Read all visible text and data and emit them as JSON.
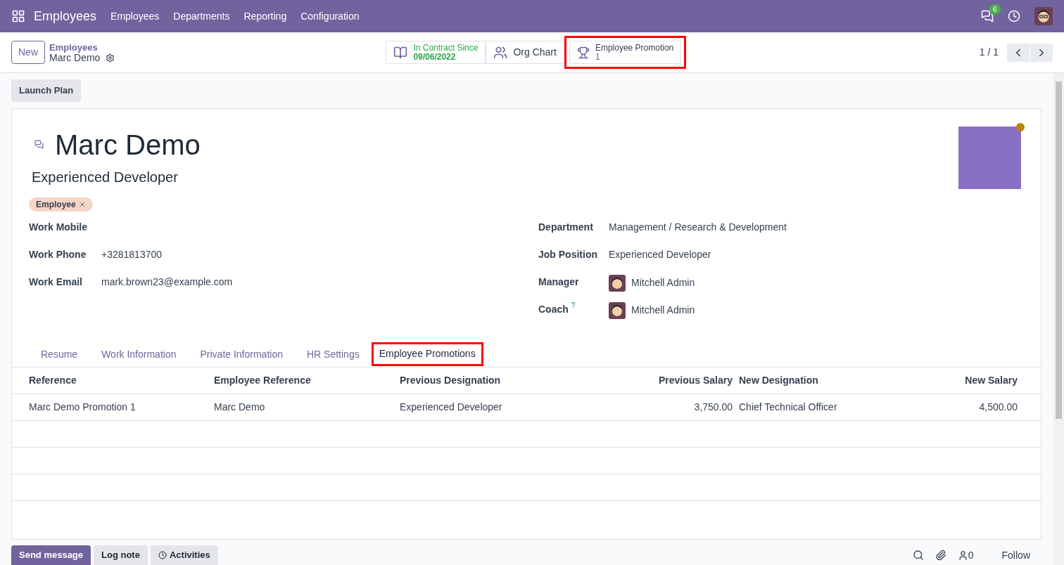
{
  "navbar": {
    "app": "Employees",
    "menu": [
      "Employees",
      "Departments",
      "Reporting",
      "Configuration"
    ],
    "messages_count": "6"
  },
  "control_panel": {
    "new_button": "New",
    "breadcrumb": "Employees",
    "record": "Marc Demo",
    "pager": "1 / 1"
  },
  "stat_buttons": [
    {
      "kind": "contract",
      "label": "In Contract Since",
      "value": "09/06/2022",
      "highlighted": false
    },
    {
      "kind": "orgchart",
      "label": "Org Chart",
      "highlighted": false
    },
    {
      "kind": "promotion",
      "label": "Employee Promotion",
      "value": "1",
      "highlighted": true
    }
  ],
  "launch_plan": "Launch Plan",
  "employee": {
    "name": "Marc Demo",
    "job_title": "Experienced Developer",
    "tags": [
      {
        "label": "Employee",
        "color": "#f6d5c8"
      }
    ]
  },
  "left_fields": [
    {
      "label": "Work Mobile"
    },
    {
      "label": "Work Phone",
      "value": "+3281813700"
    },
    {
      "label": "Work Email",
      "value": "mark.brown23@example.com"
    }
  ],
  "right_fields": [
    {
      "label": "Department",
      "value": "Management / Research & Development",
      "avatar": false
    },
    {
      "label": "Job Position",
      "value": "Experienced Developer",
      "avatar": false
    },
    {
      "label": "Manager",
      "value": "Mitchell Admin",
      "avatar": true
    },
    {
      "label": "Coach",
      "value": "Mitchell Admin",
      "avatar": true,
      "help_mark": "?"
    }
  ],
  "tabs": [
    {
      "label": "Resume",
      "selected": false,
      "highlighted": false
    },
    {
      "label": "Work Information",
      "selected": false,
      "highlighted": false
    },
    {
      "label": "Private Information",
      "selected": false,
      "highlighted": false
    },
    {
      "label": "HR Settings",
      "selected": false,
      "highlighted": false
    },
    {
      "label": "Employee Promotions",
      "selected": true,
      "highlighted": true
    }
  ],
  "table": {
    "columns": [
      "Reference",
      "Employee Reference",
      "Previous Designation",
      "Previous Salary",
      "New Designation",
      "New Salary"
    ],
    "rows": [
      [
        "Marc Demo Promotion 1",
        "Marc Demo",
        "Experienced Developer",
        "3,750.00",
        "Chief Technical Officer",
        "4,500.00"
      ]
    ]
  },
  "chatter": {
    "buttons": [
      {
        "label": "Send message",
        "selected": true
      },
      {
        "label": "Log note",
        "selected": false
      },
      {
        "label": "Activities",
        "selected": false
      }
    ],
    "followers": "0",
    "follow": "Follow"
  }
}
